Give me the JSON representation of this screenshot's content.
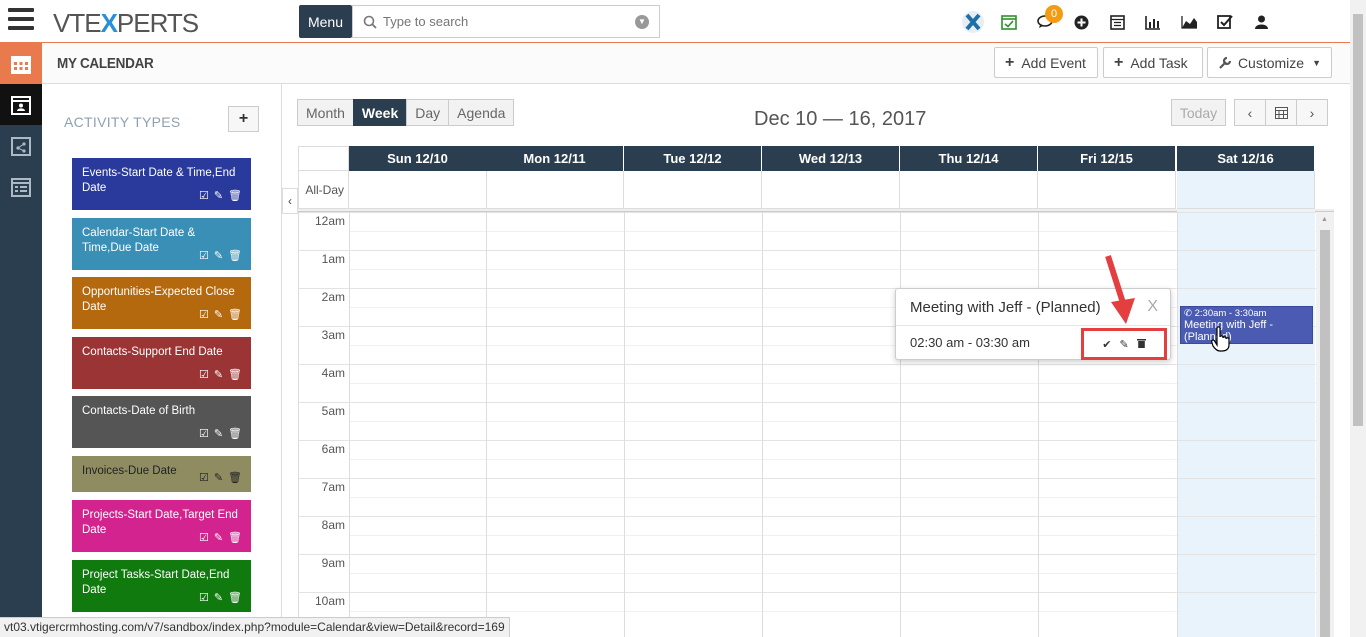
{
  "brand": {
    "logo_pre": "VT",
    "logo_mid": "E",
    "logo_x": "X",
    "logo_post": "PERTS"
  },
  "topbar": {
    "menu_label": "Menu",
    "search_placeholder": "Type to search",
    "notifications_count": "0"
  },
  "page": {
    "title": "MY CALENDAR"
  },
  "header_buttons": {
    "add_event": "Add Event",
    "add_task": "Add Task",
    "customize": "Customize"
  },
  "sidebar": {
    "title": "ACTIVITY TYPES",
    "add_label": "+",
    "items": [
      {
        "label": "Events-Start Date & Time,End Date",
        "color": "#2a3a9c"
      },
      {
        "label": "Calendar-Start Date & Time,Due Date",
        "color": "#3a8fb7"
      },
      {
        "label": "Opportunities-Expected Close Date",
        "color": "#b4690e"
      },
      {
        "label": "Contacts-Support End Date",
        "color": "#9b3535"
      },
      {
        "label": "Contacts-Date of Birth",
        "color": "#555555"
      },
      {
        "label": "Invoices-Due Date",
        "color": "#8f8c62"
      },
      {
        "label": "Projects-Start Date,Target End Date",
        "color": "#d2238e"
      },
      {
        "label": "Project Tasks-Start Date,End Date",
        "color": "#107a0e"
      }
    ]
  },
  "views": {
    "month": "Month",
    "week": "Week",
    "day": "Day",
    "agenda": "Agenda",
    "active": "Week"
  },
  "range_title": "Dec 10 — 16, 2017",
  "nav": {
    "today": "Today"
  },
  "days": [
    "Sun 12/10",
    "Mon 12/11",
    "Tue 12/12",
    "Wed 12/13",
    "Thu 12/14",
    "Fri 12/15",
    "Sat 12/16"
  ],
  "allday_label": "All-Day",
  "times": [
    "12am",
    "1am",
    "2am",
    "3am",
    "4am",
    "5am",
    "6am",
    "7am",
    "8am",
    "9am",
    "10am"
  ],
  "event": {
    "time": "2:30am - 3:30am",
    "title": "Meeting with Jeff - (Planned)",
    "color": "#4b5bb1"
  },
  "popover": {
    "title": "Meeting with Jeff - (Planned)",
    "close": "X",
    "time": "02:30 am - 03:30 am"
  },
  "status_url": "vt03.vtigercrmhosting.com/v7/sandbox/index.php?module=Calendar&view=Detail&record=169",
  "colors": {
    "nav_dark": "#2b3e50",
    "accent_orange": "#e97a4d",
    "annotation_red": "#e53e3e",
    "today_col": "#e8f3fc"
  }
}
